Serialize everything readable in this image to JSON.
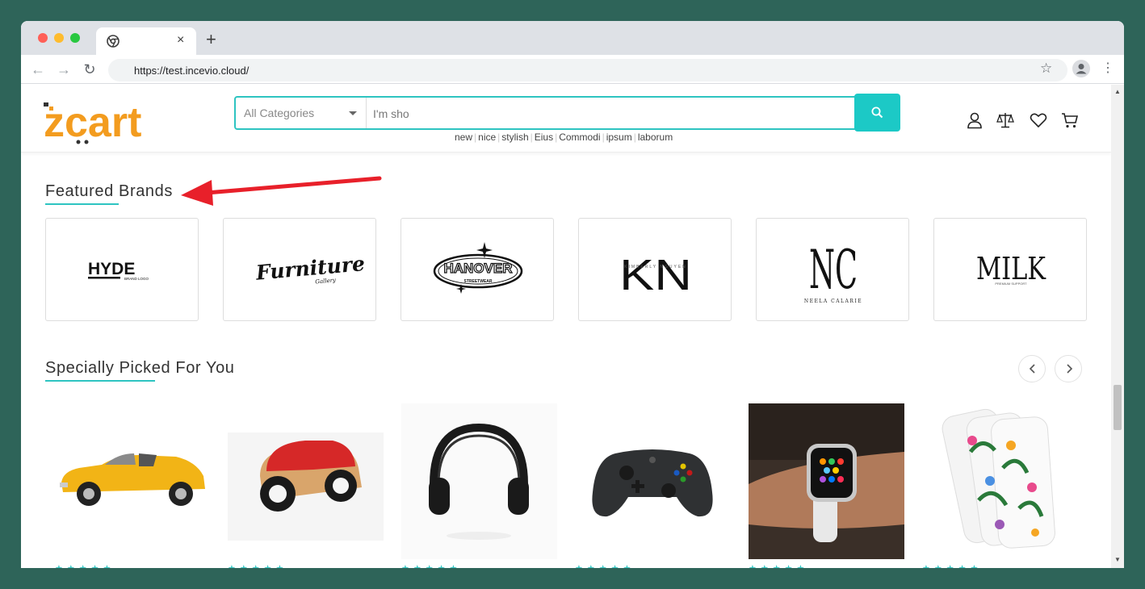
{
  "browser": {
    "tab_title": "",
    "url": "https://test.incevio.cloud/",
    "new_tab_label": "+",
    "close_label": "×"
  },
  "header": {
    "logo_text": "zcart",
    "category_select": "All Categories",
    "search_value": "I'm sho",
    "tags": [
      "new",
      "nice",
      "stylish",
      "Eius",
      "Commodi",
      "ipsum",
      "laborum"
    ],
    "accent_color": "#1cc9c6",
    "brand_color": "#f39c1f"
  },
  "featured_brands": {
    "title": "Featured Brands",
    "brands": [
      {
        "name": "HYDE",
        "tagline": "BRAND LOGO"
      },
      {
        "name": "Furniture",
        "tagline": "Gallery"
      },
      {
        "name": "HANOVER",
        "tagline": "STREETWEAR"
      },
      {
        "name": "KN",
        "tagline": "KIMBERLY NGUYEN"
      },
      {
        "name": "NC",
        "tagline": "NEELA CALARIE"
      },
      {
        "name": "MILK",
        "tagline": "PREMIUM SUPPORT"
      }
    ]
  },
  "picked": {
    "title": "Specially Picked For You",
    "products": [
      {
        "image": "yellow-convertible-car"
      },
      {
        "image": "wooden-toy-car"
      },
      {
        "image": "black-headphones"
      },
      {
        "image": "game-controller"
      },
      {
        "image": "smart-watch-on-wrist"
      },
      {
        "image": "floral-phone-cases"
      }
    ],
    "rating_stars": "★★★★★"
  }
}
